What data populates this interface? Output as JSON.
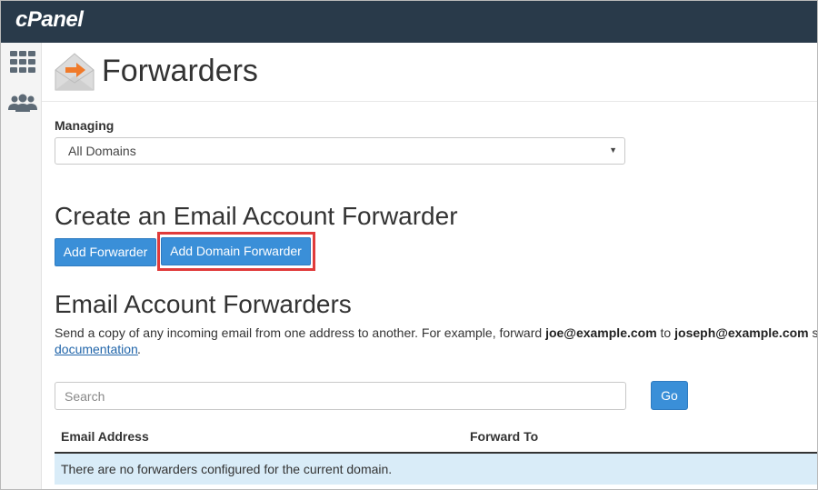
{
  "app": {
    "logo": "cPanel"
  },
  "sidebar": {
    "items": [
      {
        "icon": "grid-icon"
      },
      {
        "icon": "users-icon"
      }
    ]
  },
  "page": {
    "title": "Forwarders",
    "icon": "envelope-forward-icon"
  },
  "managing": {
    "label": "Managing",
    "selected": "All Domains"
  },
  "create_section": {
    "title": "Create an Email Account Forwarder",
    "add_forwarder_label": "Add Forwarder",
    "add_domain_forwarder_label": "Add Domain Forwarder",
    "highlight_color": "#e03b3b"
  },
  "forwarders_section": {
    "title": "Email Account Forwarders",
    "description_parts": {
      "p1": "Send a copy of any incoming email from one address to another. For example, forward ",
      "email1": "joe@example.com",
      "p2": " to ",
      "email2": "joseph@example.com",
      "p3": " so that"
    },
    "doc_link": "documentation",
    "doc_suffix": "."
  },
  "search": {
    "placeholder": "Search",
    "go_label": "Go"
  },
  "table": {
    "columns": [
      "Email Address",
      "Forward To"
    ],
    "empty_message": "There are no forwarders configured for the current domain."
  },
  "colors": {
    "topbar": "#293a4a",
    "button": "#3a8fd8",
    "empty_row": "#d9ecf8",
    "link": "#2266aa"
  }
}
